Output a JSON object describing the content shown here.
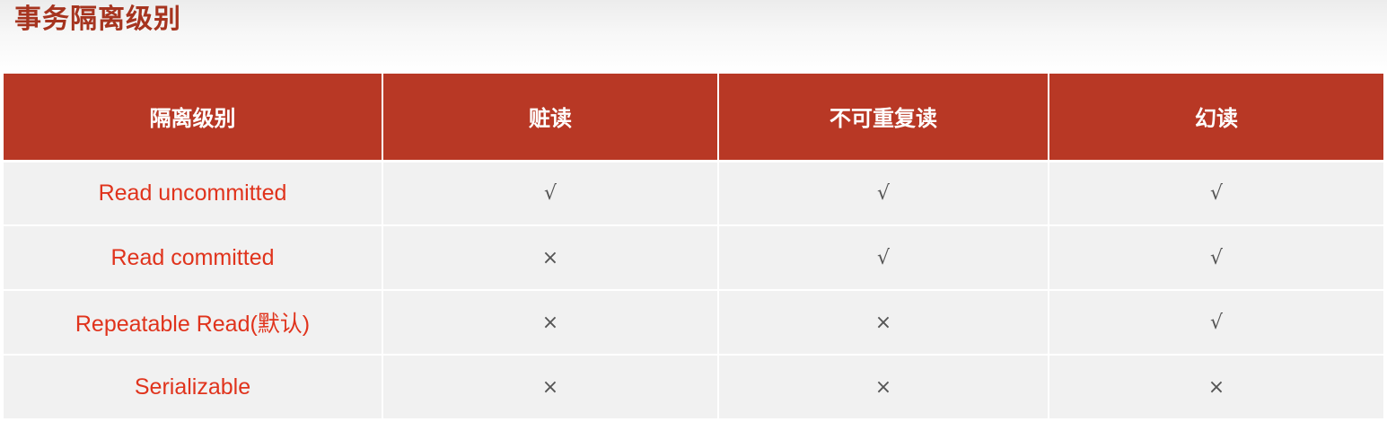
{
  "page": {
    "title": "事务隔离级别"
  },
  "table": {
    "headers": [
      "隔离级别",
      "赃读",
      "不可重复读",
      "幻读"
    ],
    "rows": [
      {
        "level": "Read uncommitted",
        "dirty_read": "√",
        "non_repeatable_read": "√",
        "phantom_read": "√"
      },
      {
        "level": "Read committed",
        "dirty_read": "×",
        "non_repeatable_read": "√",
        "phantom_read": "√"
      },
      {
        "level": "Repeatable Read(默认)",
        "dirty_read": "×",
        "non_repeatable_read": "×",
        "phantom_read": "√"
      },
      {
        "level": "Serializable",
        "dirty_read": "×",
        "non_repeatable_read": "×",
        "phantom_read": "×"
      }
    ]
  },
  "colors": {
    "title": "#a6341f",
    "header_bg": "#b83825",
    "header_text": "#ffffff",
    "cell_bg": "#f1f1f1",
    "level_text": "#e0331c",
    "mark_text": "#555555"
  }
}
